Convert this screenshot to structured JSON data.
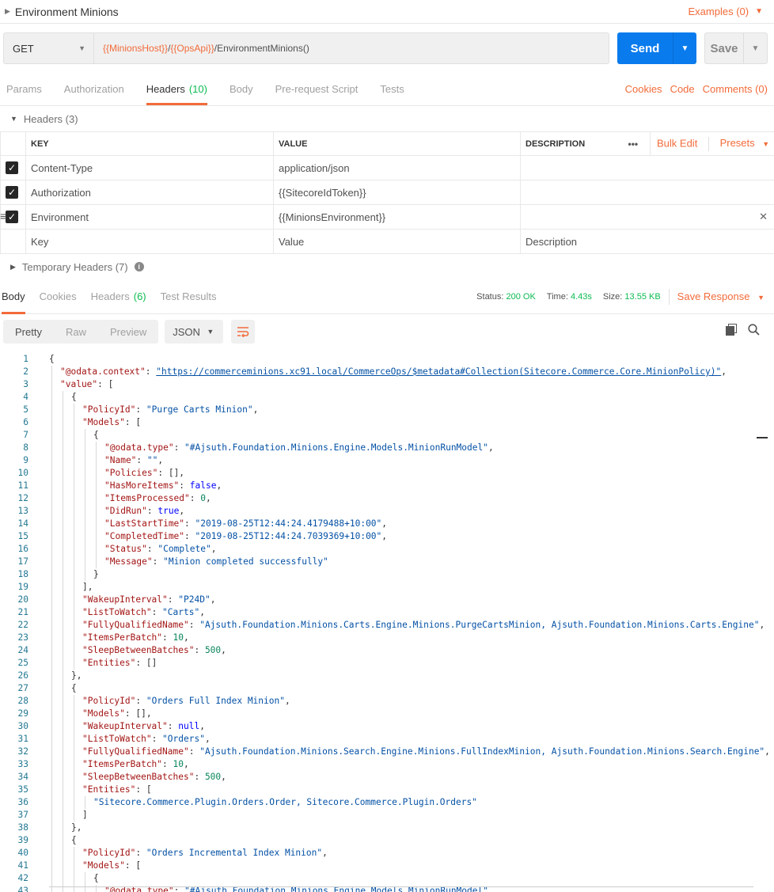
{
  "title": {
    "name": "Environment Minions",
    "examples": "Examples (0)"
  },
  "request": {
    "method": "GET",
    "url_parts": [
      {
        "text": "{{MinionsHost}}",
        "var": true
      },
      {
        "text": "/",
        "var": false
      },
      {
        "text": "{{OpsApi}}",
        "var": true
      },
      {
        "text": "/EnvironmentMinions()",
        "var": false
      }
    ],
    "send_label": "Send",
    "save_label": "Save"
  },
  "request_tabs": [
    {
      "label": "Params",
      "count": ""
    },
    {
      "label": "Authorization",
      "count": ""
    },
    {
      "label": "Headers",
      "count": "(10)",
      "active": true
    },
    {
      "label": "Body",
      "count": ""
    },
    {
      "label": "Pre-request Script",
      "count": ""
    },
    {
      "label": "Tests",
      "count": ""
    }
  ],
  "request_links": {
    "cookies": "Cookies",
    "code": "Code",
    "comments": "Comments (0)"
  },
  "headers_section": {
    "label": "Headers (3)"
  },
  "headers_table": {
    "columns": {
      "key": "KEY",
      "value": "VALUE",
      "description": "DESCRIPTION",
      "more": "•••",
      "bulk_edit": "Bulk Edit",
      "presets": "Presets"
    },
    "rows": [
      {
        "key": "Content-Type",
        "value": "application/json",
        "value_var": false
      },
      {
        "key": "Authorization",
        "value": "{{SitecoreIdToken}}",
        "value_var": true
      },
      {
        "key": "Environment",
        "value": "{{MinionsEnvironment}}",
        "value_var": true
      }
    ],
    "placeholders": {
      "key": "Key",
      "value": "Value",
      "description": "Description"
    }
  },
  "temp_headers": {
    "label": "Temporary Headers (7)"
  },
  "response_tabs": [
    {
      "label": "Body",
      "count": "",
      "active": true
    },
    {
      "label": "Cookies",
      "count": ""
    },
    {
      "label": "Headers",
      "count": "(6)"
    },
    {
      "label": "Test Results",
      "count": ""
    }
  ],
  "response_meta": {
    "status_label": "Status:",
    "status": "200 OK",
    "time_label": "Time:",
    "time": "4.43s",
    "size_label": "Size:",
    "size": "13.55 KB",
    "save_response": "Save Response"
  },
  "view_modes": [
    "Pretty",
    "Raw",
    "Preview"
  ],
  "format": "JSON",
  "code_lines": [
    {
      "i": 0,
      "p": [
        [
          "p",
          "{"
        ]
      ]
    },
    {
      "i": 1,
      "p": [
        [
          "k",
          "\"@odata.context\""
        ],
        [
          "p",
          ": "
        ],
        [
          "u",
          "\"https://commerceminions.xc91.local/CommerceOps/$metadata#Collection(Sitecore.Commerce.Core.MinionPolicy)\""
        ],
        [
          "p",
          ","
        ]
      ]
    },
    {
      "i": 1,
      "p": [
        [
          "k",
          "\"value\""
        ],
        [
          "p",
          ": ["
        ]
      ]
    },
    {
      "i": 2,
      "p": [
        [
          "p",
          "{"
        ]
      ]
    },
    {
      "i": 3,
      "p": [
        [
          "k",
          "\"PolicyId\""
        ],
        [
          "p",
          ": "
        ],
        [
          "s",
          "\"Purge Carts Minion\""
        ],
        [
          "p",
          ","
        ]
      ]
    },
    {
      "i": 3,
      "p": [
        [
          "k",
          "\"Models\""
        ],
        [
          "p",
          ": ["
        ]
      ]
    },
    {
      "i": 4,
      "p": [
        [
          "p",
          "{"
        ]
      ]
    },
    {
      "i": 5,
      "p": [
        [
          "k",
          "\"@odata.type\""
        ],
        [
          "p",
          ": "
        ],
        [
          "s",
          "\"#Ajsuth.Foundation.Minions.Engine.Models.MinionRunModel\""
        ],
        [
          "p",
          ","
        ]
      ]
    },
    {
      "i": 5,
      "p": [
        [
          "k",
          "\"Name\""
        ],
        [
          "p",
          ": "
        ],
        [
          "s",
          "\"\""
        ],
        [
          "p",
          ","
        ]
      ]
    },
    {
      "i": 5,
      "p": [
        [
          "k",
          "\"Policies\""
        ],
        [
          "p",
          ": [],"
        ]
      ]
    },
    {
      "i": 5,
      "p": [
        [
          "k",
          "\"HasMoreItems\""
        ],
        [
          "p",
          ": "
        ],
        [
          "b",
          "false"
        ],
        [
          "p",
          ","
        ]
      ]
    },
    {
      "i": 5,
      "p": [
        [
          "k",
          "\"ItemsProcessed\""
        ],
        [
          "p",
          ": "
        ],
        [
          "n",
          "0"
        ],
        [
          "p",
          ","
        ]
      ]
    },
    {
      "i": 5,
      "p": [
        [
          "k",
          "\"DidRun\""
        ],
        [
          "p",
          ": "
        ],
        [
          "b",
          "true"
        ],
        [
          "p",
          ","
        ]
      ]
    },
    {
      "i": 5,
      "p": [
        [
          "k",
          "\"LastStartTime\""
        ],
        [
          "p",
          ": "
        ],
        [
          "s",
          "\"2019-08-25T12:44:24.4179488+10:00\""
        ],
        [
          "p",
          ","
        ]
      ]
    },
    {
      "i": 5,
      "p": [
        [
          "k",
          "\"CompletedTime\""
        ],
        [
          "p",
          ": "
        ],
        [
          "s",
          "\"2019-08-25T12:44:24.7039369+10:00\""
        ],
        [
          "p",
          ","
        ]
      ]
    },
    {
      "i": 5,
      "p": [
        [
          "k",
          "\"Status\""
        ],
        [
          "p",
          ": "
        ],
        [
          "s",
          "\"Complete\""
        ],
        [
          "p",
          ","
        ]
      ]
    },
    {
      "i": 5,
      "p": [
        [
          "k",
          "\"Message\""
        ],
        [
          "p",
          ": "
        ],
        [
          "s",
          "\"Minion completed successfully\""
        ]
      ]
    },
    {
      "i": 4,
      "p": [
        [
          "p",
          "}"
        ]
      ]
    },
    {
      "i": 3,
      "p": [
        [
          "p",
          "],"
        ]
      ]
    },
    {
      "i": 3,
      "p": [
        [
          "k",
          "\"WakeupInterval\""
        ],
        [
          "p",
          ": "
        ],
        [
          "s",
          "\"P24D\""
        ],
        [
          "p",
          ","
        ]
      ]
    },
    {
      "i": 3,
      "p": [
        [
          "k",
          "\"ListToWatch\""
        ],
        [
          "p",
          ": "
        ],
        [
          "s",
          "\"Carts\""
        ],
        [
          "p",
          ","
        ]
      ]
    },
    {
      "i": 3,
      "p": [
        [
          "k",
          "\"FullyQualifiedName\""
        ],
        [
          "p",
          ": "
        ],
        [
          "s",
          "\"Ajsuth.Foundation.Minions.Carts.Engine.Minions.PurgeCartsMinion, Ajsuth.Foundation.Minions.Carts.Engine\""
        ],
        [
          "p",
          ","
        ]
      ]
    },
    {
      "i": 3,
      "p": [
        [
          "k",
          "\"ItemsPerBatch\""
        ],
        [
          "p",
          ": "
        ],
        [
          "n",
          "10"
        ],
        [
          "p",
          ","
        ]
      ]
    },
    {
      "i": 3,
      "p": [
        [
          "k",
          "\"SleepBetweenBatches\""
        ],
        [
          "p",
          ": "
        ],
        [
          "n",
          "500"
        ],
        [
          "p",
          ","
        ]
      ]
    },
    {
      "i": 3,
      "p": [
        [
          "k",
          "\"Entities\""
        ],
        [
          "p",
          ": []"
        ]
      ]
    },
    {
      "i": 2,
      "p": [
        [
          "p",
          "},"
        ]
      ]
    },
    {
      "i": 2,
      "p": [
        [
          "p",
          "{"
        ]
      ]
    },
    {
      "i": 3,
      "p": [
        [
          "k",
          "\"PolicyId\""
        ],
        [
          "p",
          ": "
        ],
        [
          "s",
          "\"Orders Full Index Minion\""
        ],
        [
          "p",
          ","
        ]
      ]
    },
    {
      "i": 3,
      "p": [
        [
          "k",
          "\"Models\""
        ],
        [
          "p",
          ": [],"
        ]
      ]
    },
    {
      "i": 3,
      "p": [
        [
          "k",
          "\"WakeupInterval\""
        ],
        [
          "p",
          ": "
        ],
        [
          "b",
          "null"
        ],
        [
          "p",
          ","
        ]
      ]
    },
    {
      "i": 3,
      "p": [
        [
          "k",
          "\"ListToWatch\""
        ],
        [
          "p",
          ": "
        ],
        [
          "s",
          "\"Orders\""
        ],
        [
          "p",
          ","
        ]
      ]
    },
    {
      "i": 3,
      "p": [
        [
          "k",
          "\"FullyQualifiedName\""
        ],
        [
          "p",
          ": "
        ],
        [
          "s",
          "\"Ajsuth.Foundation.Minions.Search.Engine.Minions.FullIndexMinion, Ajsuth.Foundation.Minions.Search.Engine\""
        ],
        [
          "p",
          ","
        ]
      ]
    },
    {
      "i": 3,
      "p": [
        [
          "k",
          "\"ItemsPerBatch\""
        ],
        [
          "p",
          ": "
        ],
        [
          "n",
          "10"
        ],
        [
          "p",
          ","
        ]
      ]
    },
    {
      "i": 3,
      "p": [
        [
          "k",
          "\"SleepBetweenBatches\""
        ],
        [
          "p",
          ": "
        ],
        [
          "n",
          "500"
        ],
        [
          "p",
          ","
        ]
      ]
    },
    {
      "i": 3,
      "p": [
        [
          "k",
          "\"Entities\""
        ],
        [
          "p",
          ": ["
        ]
      ]
    },
    {
      "i": 4,
      "p": [
        [
          "s",
          "\"Sitecore.Commerce.Plugin.Orders.Order, Sitecore.Commerce.Plugin.Orders\""
        ]
      ]
    },
    {
      "i": 3,
      "p": [
        [
          "p",
          "]"
        ]
      ]
    },
    {
      "i": 2,
      "p": [
        [
          "p",
          "},"
        ]
      ]
    },
    {
      "i": 2,
      "p": [
        [
          "p",
          "{"
        ]
      ]
    },
    {
      "i": 3,
      "p": [
        [
          "k",
          "\"PolicyId\""
        ],
        [
          "p",
          ": "
        ],
        [
          "s",
          "\"Orders Incremental Index Minion\""
        ],
        [
          "p",
          ","
        ]
      ]
    },
    {
      "i": 3,
      "p": [
        [
          "k",
          "\"Models\""
        ],
        [
          "p",
          ": ["
        ]
      ]
    },
    {
      "i": 4,
      "p": [
        [
          "p",
          "{"
        ]
      ]
    },
    {
      "i": 5,
      "p": [
        [
          "k",
          "\"@odata.type\""
        ],
        [
          "p",
          ": "
        ],
        [
          "s",
          "\"#Ajsuth.Foundation.Minions.Engine.Models.MinionRunModel\""
        ],
        [
          "p",
          ","
        ]
      ]
    }
  ],
  "colors": {
    "accent": "#f26b3a",
    "send": "#097bed",
    "ok": "#0cbb52"
  }
}
